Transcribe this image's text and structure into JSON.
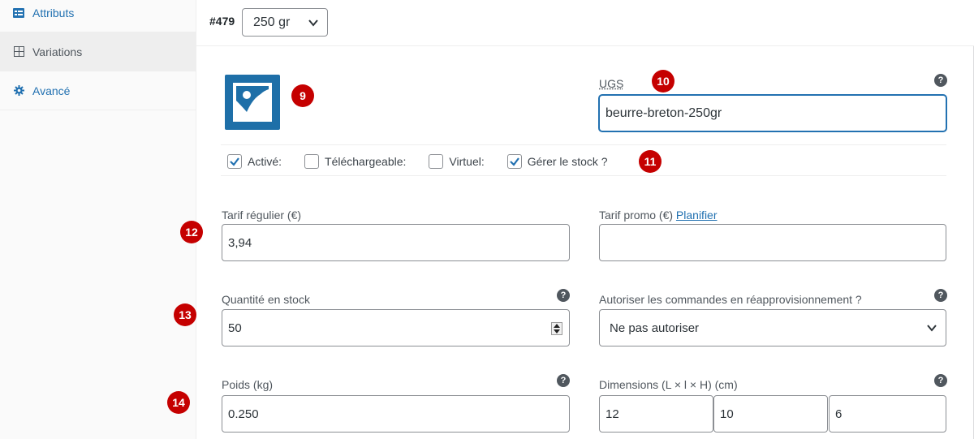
{
  "sidebar": {
    "items": [
      {
        "label": "Attributs",
        "icon": "list-icon"
      },
      {
        "label": "Variations",
        "icon": "grid-icon"
      },
      {
        "label": "Avancé",
        "icon": "gear-icon"
      }
    ]
  },
  "variation": {
    "id": "#479",
    "selected": "250 gr"
  },
  "badges": {
    "b9": "9",
    "b10": "10",
    "b11": "11",
    "b12": "12",
    "b13": "13",
    "b14": "14"
  },
  "sku": {
    "label": "UGS",
    "value": "beurre-breton-250gr"
  },
  "checkboxes": [
    {
      "label": "Activé:",
      "checked": true
    },
    {
      "label": "Téléchargeable:",
      "checked": false
    },
    {
      "label": "Virtuel:",
      "checked": false
    },
    {
      "label": "Gérer le stock ?",
      "checked": true
    }
  ],
  "regular_price": {
    "label": "Tarif régulier (€)",
    "value": "3,94"
  },
  "sale_price": {
    "label": "Tarif promo (€)",
    "link": "Planifier",
    "value": ""
  },
  "stock_qty": {
    "label": "Quantité en stock",
    "value": "50"
  },
  "backorders": {
    "label": "Autoriser les commandes en réapprovisionnement ?",
    "selected": "Ne pas autoriser"
  },
  "weight": {
    "label": "Poids (kg)",
    "value": "0.250"
  },
  "dimensions": {
    "label": "Dimensions (L × l × H) (cm)",
    "length": "12",
    "width": "10",
    "height": "6"
  },
  "colors": {
    "accent": "#2271b1",
    "badge": "#c50000",
    "thumbnail": "#1e6fa8"
  }
}
